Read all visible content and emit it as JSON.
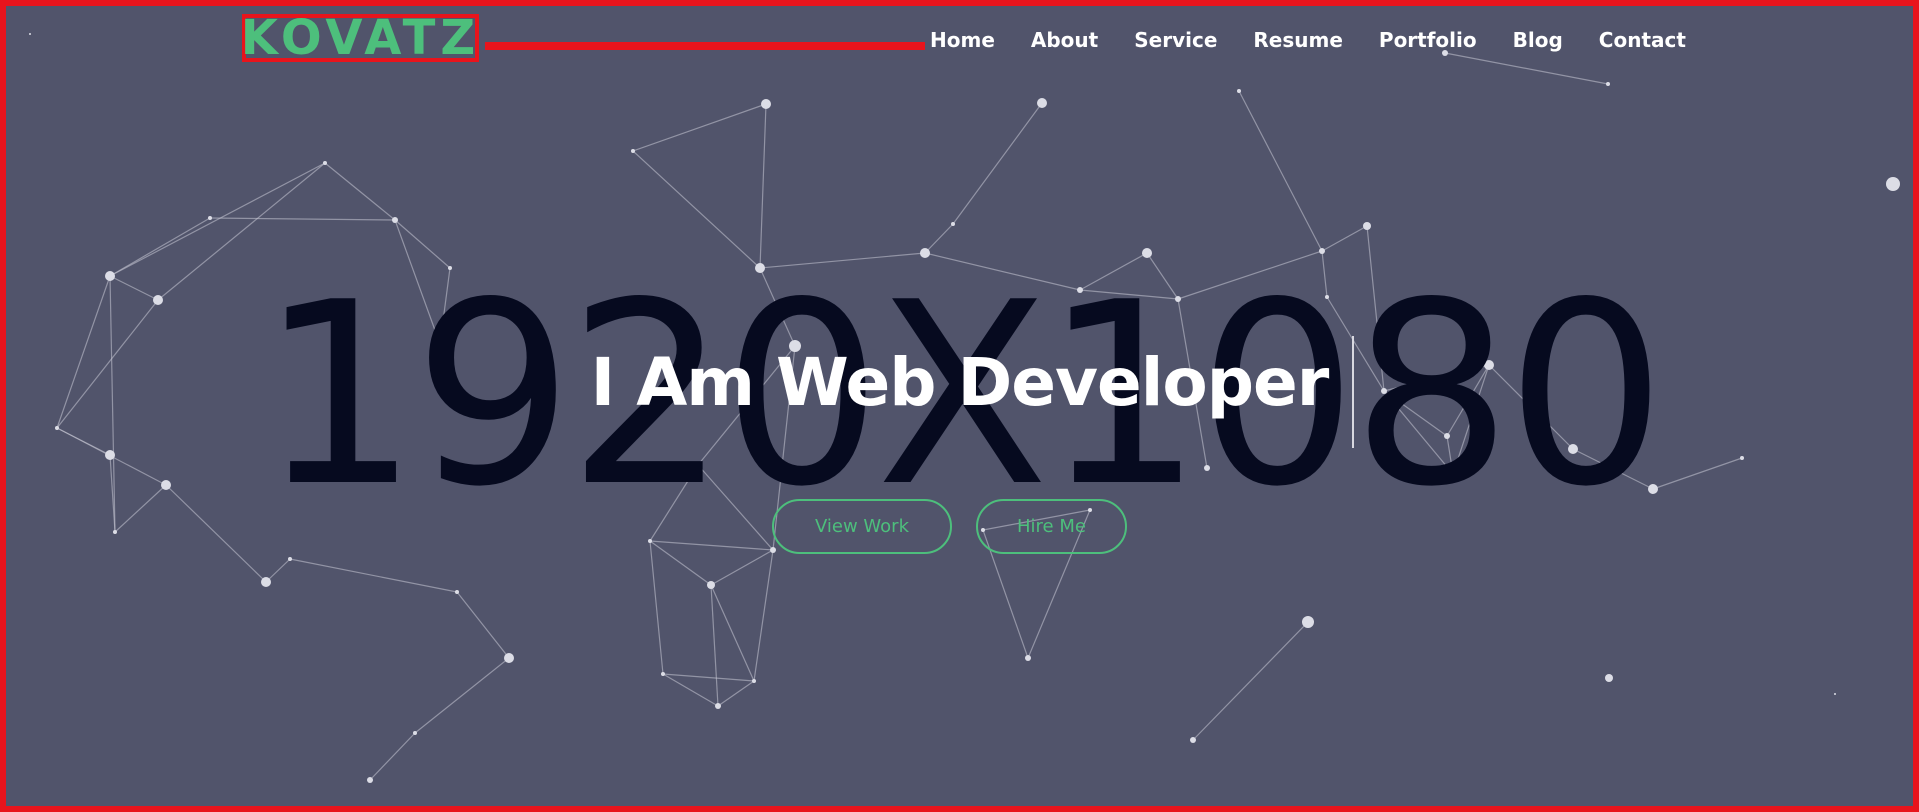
{
  "brand": {
    "logo_text": "KOVATZ",
    "accent_color": "#4dbf7c",
    "frame_color": "#e8141c"
  },
  "nav": {
    "items": [
      "Home",
      "About",
      "Service",
      "Resume",
      "Portfolio",
      "Blog",
      "Contact"
    ]
  },
  "hero": {
    "watermark_text": "1920X1080",
    "title": "I Am Web Developer",
    "buttons": {
      "view_work": "View Work",
      "hire_me": "Hire Me"
    }
  },
  "colors": {
    "background": "#51546b",
    "watermark": "#060a1f",
    "text": "#ffffff"
  }
}
